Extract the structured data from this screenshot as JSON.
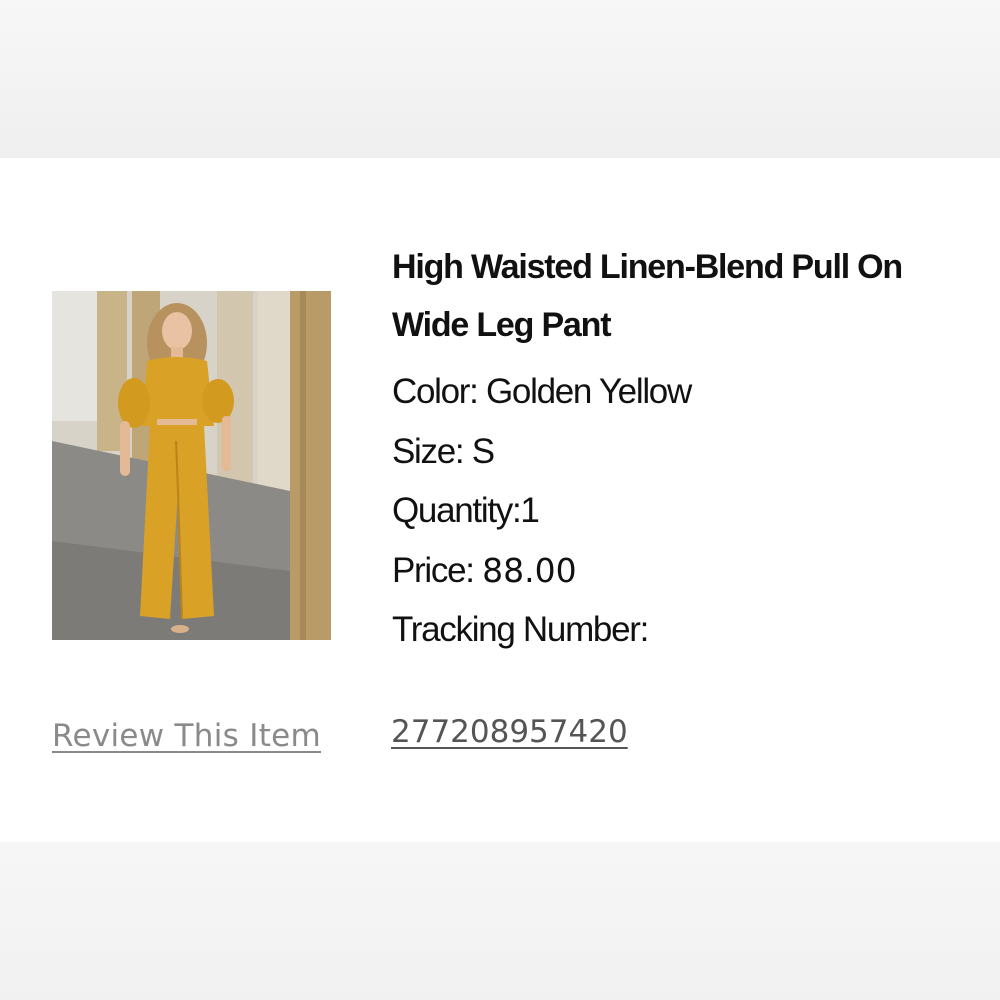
{
  "item": {
    "title": "High Waisted Linen-Blend Pull On Wide Leg Pant",
    "color_label": "Color:",
    "color_value": "Golden Yellow",
    "size_label": "Size:",
    "size_value": "S",
    "quantity_label": "Quantity:",
    "quantity_value": "1",
    "price_label": "Price:",
    "price_value": "88.00",
    "tracking_label": "Tracking Number:",
    "tracking_number": "277208957420",
    "review_link": "Review This Item",
    "photo_alt": "product-photo"
  },
  "colors": {
    "outfit": "#d9a126",
    "card_background": "#ffffff",
    "page_background": "#f2f2f2",
    "link_gray": "#8a8a8a"
  }
}
